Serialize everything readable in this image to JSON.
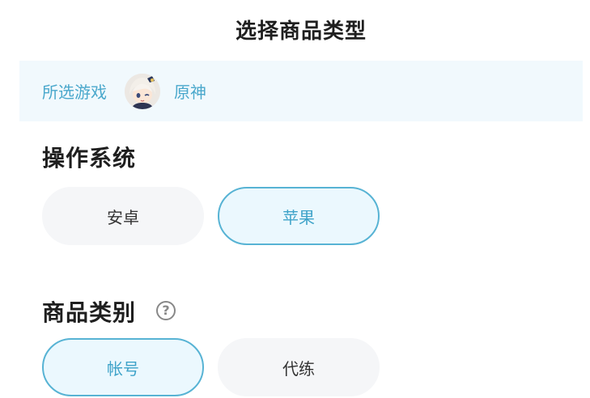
{
  "header": {
    "title": "选择商品类型"
  },
  "game_bar": {
    "label": "所选游戏",
    "avatar_icon": "game-avatar",
    "game_name": "原神"
  },
  "os_section": {
    "title": "操作系统",
    "options": [
      {
        "label": "安卓",
        "selected": false
      },
      {
        "label": "苹果",
        "selected": true
      }
    ]
  },
  "category_section": {
    "title": "商品类别",
    "help_icon": "?",
    "options": [
      {
        "label": "帐号",
        "selected": true
      },
      {
        "label": "代练",
        "selected": false
      }
    ]
  },
  "colors": {
    "accent": "#4aa8cc",
    "selected_border": "#57b3d4",
    "selected_bg": "#ebf8fe",
    "unselected_bg": "#f5f6f8",
    "game_bar_bg": "#f1f9fd"
  }
}
